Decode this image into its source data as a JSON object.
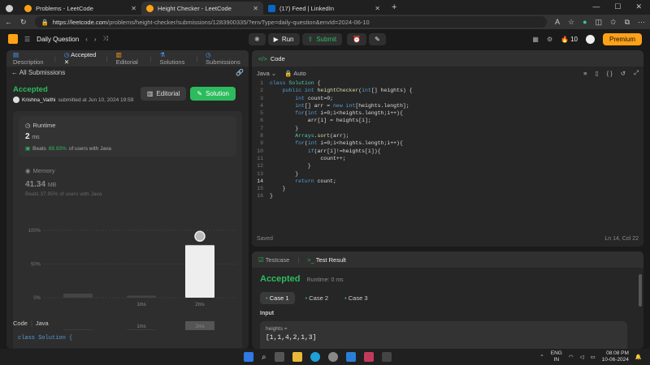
{
  "browser": {
    "tabs": [
      {
        "title": "Problems - LeetCode",
        "active": false
      },
      {
        "title": "Height Checker - LeetCode",
        "active": true
      },
      {
        "title": "(17) Feed | LinkedIn",
        "active": false
      }
    ],
    "url_host": "https://leetcode.com",
    "url_path": "/problems/height-checker/submissions/1283900335/?envType=daily-question&envId=2024-06-10"
  },
  "nav": {
    "daily": "Daily Question",
    "run": "Run",
    "submit": "Submit",
    "streak": "10",
    "premium": "Premium"
  },
  "left": {
    "tabs": [
      "Description",
      "Accepted",
      "Editorial",
      "Solutions",
      "Submissions"
    ],
    "all_submissions": "All Submissions",
    "status": "Accepted",
    "user": "Krishna_Vaithi",
    "submitted": "submitted at Jun 10, 2024 19:59",
    "editorial_btn": "Editorial",
    "solution_btn": "Solution",
    "runtime_label": "Runtime",
    "runtime_value": "2",
    "runtime_unit": "ms",
    "beats_prefix": "Beats",
    "beats_pct": "88.93%",
    "beats_suffix": "of users with Java",
    "memory_label": "Memory",
    "memory_value": "41.34",
    "memory_unit": "MB",
    "memory_beats": "Beats 37.95% of users with Java",
    "y_ticks": [
      "100%",
      "50%",
      "0%"
    ],
    "x_labels": [
      "1ms",
      "2ms"
    ],
    "x_labels_lower": [
      "1ms",
      "2ms"
    ],
    "code_label": "Code",
    "code_lang": "Java",
    "code_preview": "class Solution {"
  },
  "code": {
    "title": "Code",
    "lang": "Java",
    "mode": "Auto",
    "lines": [
      "class Solution {",
      "    public int heightChecker(int[] heights) {",
      "        int count=0;",
      "        int[] arr = new int[heights.length];",
      "        for(int i=0;i<heights.length;i++){",
      "            arr[i] = heights[i];",
      "        }",
      "        Arrays.sort(arr);",
      "        for(int i=0;i<heights.length;i++){",
      "            if(arr[i]!=heights[i]){",
      "                count++;",
      "            }",
      "        }",
      "        return count;",
      "    }",
      "}"
    ],
    "saved": "Saved",
    "cursor": "Ln 14, Col 22"
  },
  "result": {
    "tab1": "Testcase",
    "tab2": "Test Result",
    "status": "Accepted",
    "runtime": "Runtime: 0 ms",
    "cases": [
      "Case 1",
      "Case 2",
      "Case 3"
    ],
    "input_label": "Input",
    "param": "heights =",
    "value": "[1,1,4,2,1,3]"
  },
  "taskbar": {
    "lang": "ENG",
    "region": "IN",
    "time": "08:08 PM",
    "date": "10-06-2024"
  },
  "chart_data": {
    "type": "bar",
    "categories": [
      "",
      "1ms",
      "2ms"
    ],
    "values": [
      6,
      3,
      78
    ],
    "ylim": [
      0,
      100
    ],
    "highlight": "2ms"
  }
}
